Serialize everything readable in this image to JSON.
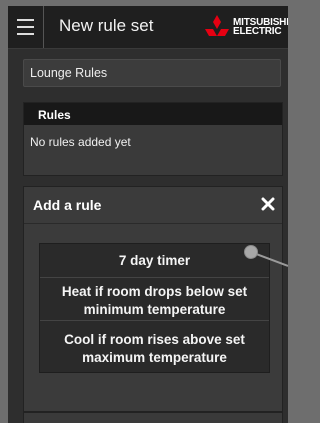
{
  "header": {
    "title": "New rule set",
    "menu_icon": "hamburger-menu-icon",
    "logo_lines": [
      "MITSUBISHI",
      "ELECTRIC"
    ]
  },
  "rule_set": {
    "name": "Lounge Rules"
  },
  "rules": {
    "title": "Rules",
    "empty_message": "No rules added yet"
  },
  "add_rule": {
    "title": "Add a rule",
    "close_icon": "close-x-icon",
    "options": [
      {
        "label": "7 day timer"
      },
      {
        "label_lines": [
          "Heat if room drops below set",
          "minimum temperature"
        ]
      },
      {
        "label_lines": [
          "Cool if room rises above set",
          "maximum temperature"
        ]
      }
    ]
  },
  "colors": {
    "background": "#2e2e2e",
    "header": "#1f1f1f",
    "brand_red": "#e60012"
  }
}
